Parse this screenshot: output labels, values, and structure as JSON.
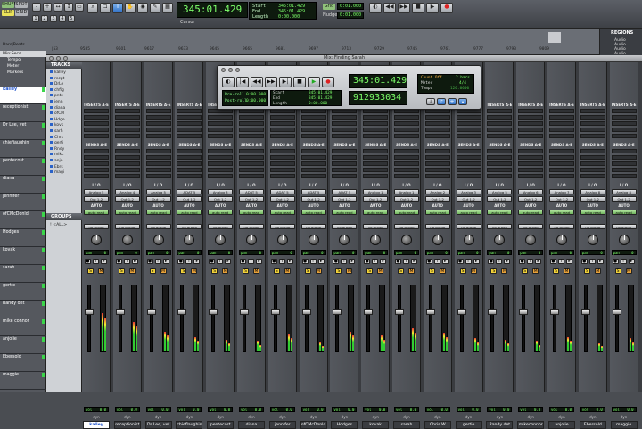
{
  "toolbar": {
    "mode_buttons": [
      "SHUFFLE",
      "SPOT",
      "SLIP",
      "GRID"
    ],
    "counter_main": "345:01.429",
    "start_label": "Start",
    "end_label": "End",
    "length_label": "Length",
    "start_value": "345:01.429",
    "end_value": "345:01.429",
    "length_value": "0:00.000",
    "cursor_label": "Cursor",
    "grid_label": "Grid",
    "nudge_label": "Nudge",
    "grid_value": "0:01.000",
    "nudge_value": "0:01.000"
  },
  "ruler": {
    "timelines": [
      "Bars|Beats",
      "Min:Secs",
      "Tempo",
      "Meter",
      "Markers"
    ],
    "ticks": [
      "|53",
      "9585",
      "9601",
      "9617",
      "9633",
      "9645",
      "9665",
      "9681",
      "9697",
      "9713",
      "9729",
      "9745",
      "9761",
      "9777",
      "9793",
      "9809"
    ]
  },
  "regions": {
    "title": "REGIONS",
    "items": [
      "Audio",
      "Audio",
      "Audio",
      "Audio"
    ]
  },
  "window": {
    "title": "Mix: Finding Sarah"
  },
  "tracks_panel": {
    "title": "TRACKS",
    "items": [
      "kalley",
      "recpt",
      "DrLe",
      "chfig",
      "pnte",
      "jenn",
      "diana",
      "ofCM",
      "Hdge",
      "kovk",
      "sarh",
      "Chrs",
      "gerti",
      "Rndy",
      "mikc",
      "anjo",
      "Ebrs",
      "magi"
    ]
  },
  "groups_panel": {
    "title": "GROUPS",
    "items": [
      "! <ALL>"
    ]
  },
  "left_tracks": [
    "kalley",
    "receptionist",
    "Dr Lee, vet",
    "chiefiaughin",
    "pentecost",
    "diana",
    "jennifer",
    "ofCMcDonld",
    "Hodges",
    "kovak",
    "sarah",
    "gertie",
    "Randy det",
    "mike connor",
    "anjolie",
    "Ebersold",
    "maggie"
  ],
  "transport": {
    "preroll_label": "Pre-roll",
    "postroll_label": "Post-roll",
    "preroll_value": "0:00.000",
    "postroll_value": "0:00.000",
    "start_label": "Start",
    "end_label": "End",
    "length_label": "Length",
    "start_value": "345:01.429",
    "end_value": "345:01.429",
    "length_value": "0:00.000",
    "main_counter": "345:01.429",
    "sub_counter": "912933034",
    "countoff_label": "Count Off",
    "meter_label": "Meter",
    "tempo_label": "Tempo",
    "countoff_value": "2 bars",
    "meter_value": "4/4",
    "tempo_value": "120.0000"
  },
  "mixer_labels": {
    "inserts": "INSERTS A-E",
    "sends": "SENDS A-E",
    "io": "I / O",
    "auto": "AUTO",
    "no_group": "no group",
    "pan": "pan",
    "vol": "vol",
    "dyn": "dyn"
  },
  "strips": [
    {
      "name": "kalley",
      "input": "Analog 5",
      "output": "Out 1-2",
      "auto": "auto read",
      "pan": "0",
      "vol": "0.0",
      "selected": true
    },
    {
      "name": "receptionist",
      "input": "Analog 4",
      "output": "Out 1-2",
      "auto": "auto read",
      "pan": "0",
      "vol": "0.0"
    },
    {
      "name": "Dr Lee, vet",
      "input": "Analog 5",
      "output": "Out 1-2",
      "auto": "auto read",
      "pan": "0",
      "vol": "0.0"
    },
    {
      "name": "chieflaughin",
      "input": "ADAT 5",
      "output": "Out 1-2",
      "auto": "auto read",
      "pan": "0",
      "vol": "0.0"
    },
    {
      "name": "pentecost",
      "input": "Analog 3",
      "output": "Out 1-2",
      "auto": "auto read",
      "pan": "0",
      "vol": "0.0"
    },
    {
      "name": "diana",
      "input": "ADAT 5",
      "output": "Out 1-2",
      "auto": "auto read",
      "pan": "0",
      "vol": "0.0"
    },
    {
      "name": "jennifer",
      "input": "ADAT 5",
      "output": "Out 1-2",
      "auto": "auto read",
      "pan": "0",
      "vol": "0.0"
    },
    {
      "name": "ofCMcDonld",
      "input": "ADAT 5",
      "output": "Out 1-2",
      "auto": "auto read",
      "pan": "0",
      "vol": "0.0"
    },
    {
      "name": "Hodges",
      "input": "ADAT 5",
      "output": "Out 1-2",
      "auto": "auto read",
      "pan": "0",
      "vol": "0.0"
    },
    {
      "name": "kovak",
      "input": "Analog 1",
      "output": "Out 1-2",
      "auto": "auto read",
      "pan": "0",
      "vol": "0.0"
    },
    {
      "name": "sarah",
      "input": "Analog 1",
      "output": "Out 1-2",
      "auto": "auto read",
      "pan": "0",
      "vol": "0.0"
    },
    {
      "name": "Chris W",
      "input": "Analog 2",
      "output": "Out 1-2",
      "auto": "auto read",
      "pan": "0",
      "vol": "0.0"
    },
    {
      "name": "gertie",
      "input": "Analog 3",
      "output": "Out 1-2",
      "auto": "auto read",
      "pan": "0",
      "vol": "0.0"
    },
    {
      "name": "Randy det",
      "input": "Analog 5",
      "output": "Out 1-2",
      "auto": "auto read",
      "pan": "0",
      "vol": "0.0"
    },
    {
      "name": "mikeconnor",
      "input": "Analog 6",
      "output": "Out 1-2",
      "auto": "auto read",
      "pan": "0",
      "vol": "0.0"
    },
    {
      "name": "anjolie",
      "input": "Analog 7",
      "output": "Out 1-2",
      "auto": "auto read",
      "pan": "0",
      "vol": "0.0"
    },
    {
      "name": "Ebersold",
      "input": "Analog 8",
      "output": "Out 1-2",
      "auto": "auto read",
      "pan": "0",
      "vol": "0.0"
    },
    {
      "name": "maggie",
      "input": "Analog 8",
      "output": "Out 1-2",
      "auto": "auto read",
      "pan": "0",
      "vol": "0.0"
    }
  ],
  "colors": {
    "lcd_text": "#7dff6a",
    "selected_name": "#2255cc",
    "mute": "#e8a23a",
    "solo": "#f2d23a"
  }
}
